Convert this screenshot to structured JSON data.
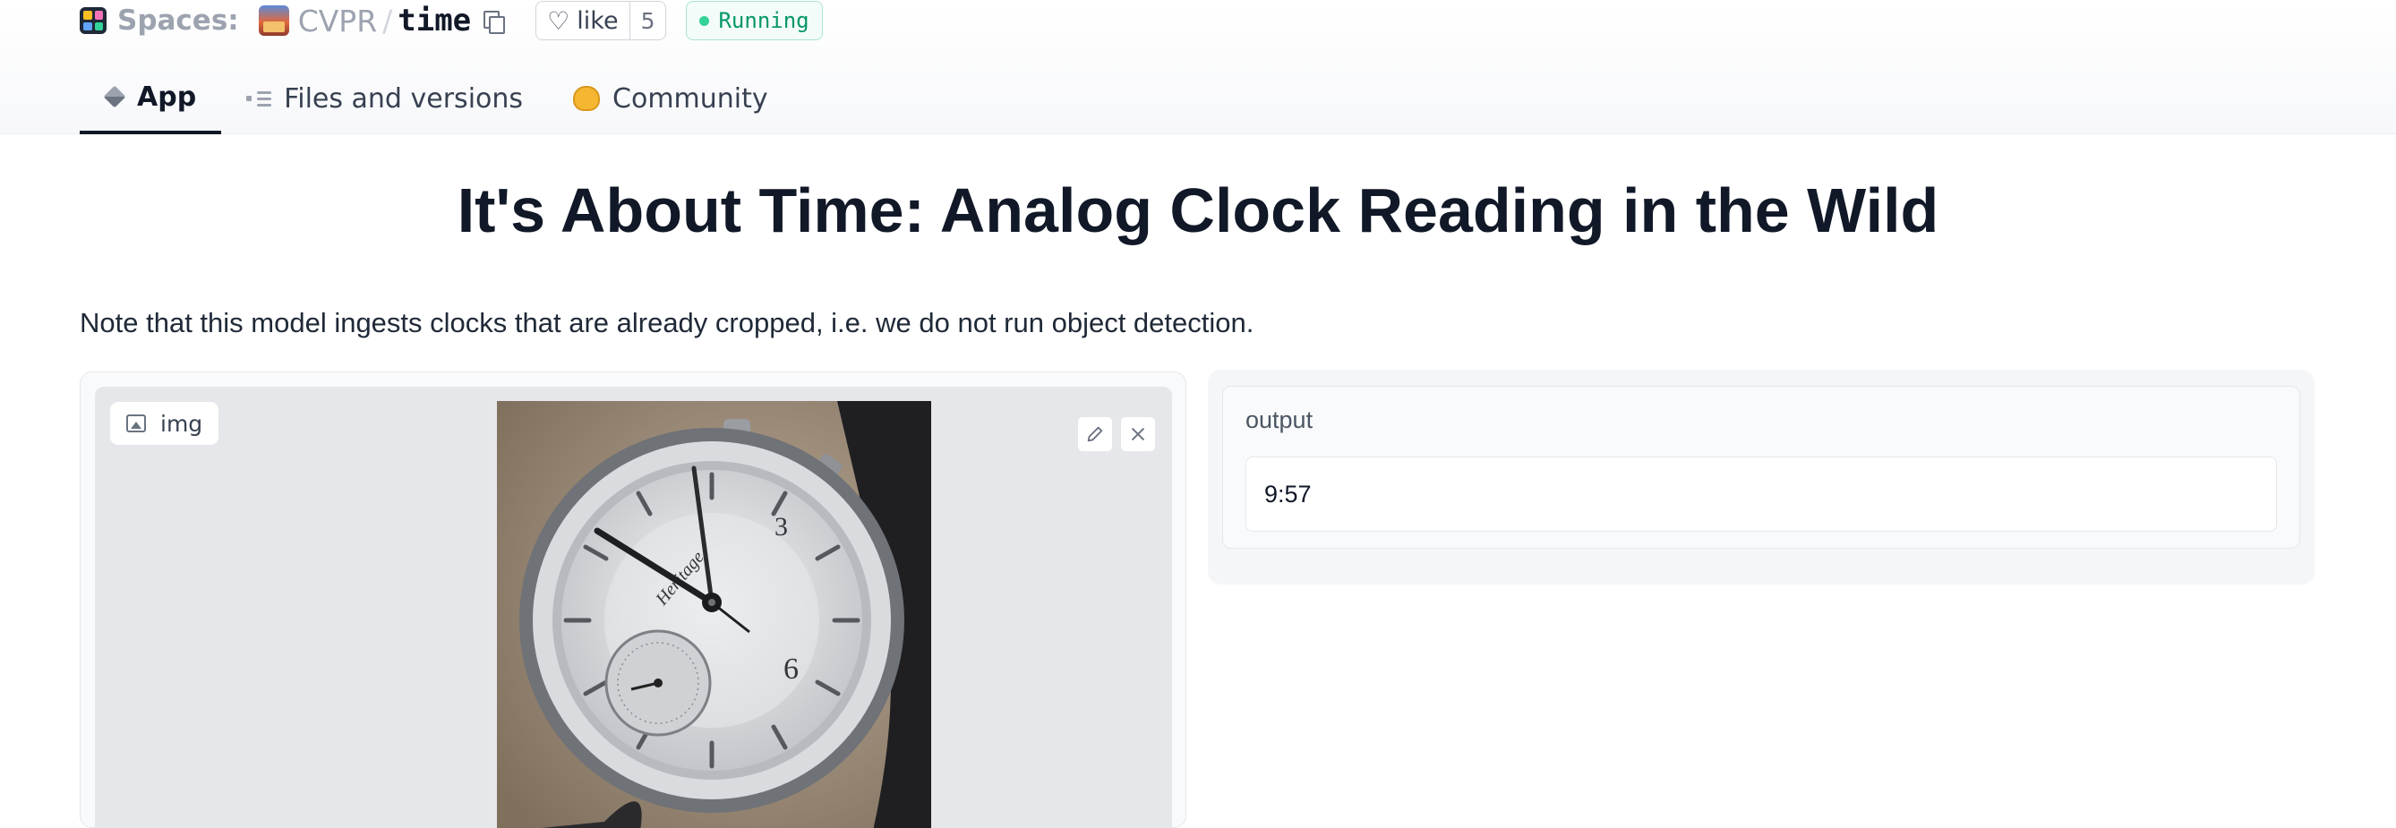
{
  "header": {
    "spaces_label": "Spaces:",
    "org": "CVPR",
    "separator": "/",
    "repo": "time",
    "like_label": "like",
    "like_count": "5",
    "status": "Running",
    "status_color": "#34d399"
  },
  "tabs": [
    {
      "label": "App",
      "icon": "cube-icon",
      "active": true
    },
    {
      "label": "Files and versions",
      "icon": "files-icon",
      "active": false
    },
    {
      "label": "Community",
      "icon": "community-icon",
      "active": false
    }
  ],
  "main": {
    "title": "It's About Time: Analog Clock Reading in the Wild",
    "note": "Note that this model ingests clocks that are already cropped, i.e. we do not run object detection.",
    "input": {
      "label": "img"
    },
    "output": {
      "label": "output",
      "value": "9:57"
    }
  }
}
